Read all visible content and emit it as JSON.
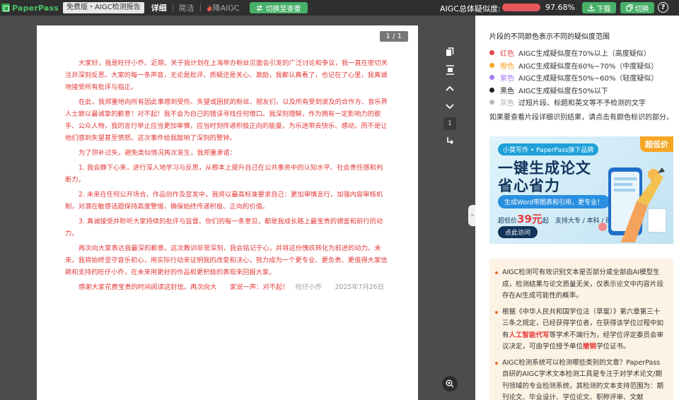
{
  "topbar": {
    "brand": "PaperPass",
    "version": "免费版・AIGC检测报告",
    "tabs": [
      "详细",
      "简洁"
    ],
    "lower_aigc": "降AIGC",
    "switch_check": "切换至查重",
    "score_label": "AIGC总体疑似度:",
    "score_value": "97.68%",
    "score_fraction": 0.9768,
    "download": "下载",
    "switch": "切换",
    "help": "?"
  },
  "viewer": {
    "page_counter": "1 / 1",
    "page_input": "1",
    "collapse": "»",
    "paragraphs": [
      "大家好，我是旺仔小乔。近期，关于我计划在上海举办粉丝见面会引发的广泛讨论和争议，我一直在密切关注并深刻反思。大家的每一条声音，无论是批评、质疑还是关心、激励，我都认真看了，也记在了心里，我真诚地接受所有批评与指正。",
      "在此，我郑重地向所有因此事感到受伤、失望或困扰的粉丝、朋友们，以及所有受到波及的合作方、音乐界人士致以最诚挚的歉意！对不起！我不会为自己的错误寻找任何借口。我深刻理解，作为拥有一定影响力的歌手、公众人物，我的言行举止应当更加审慎，应当时刻传递积极正向的能量，为乐迷带去快乐、感动，而不是让他们感到失望甚至愤怒。这次事件给我敲响了深刻的警钟。",
      "为了弥补过失，避免类似情况再次发生，我郑重承诺：",
      "1. 我会静下心来，进行深入地学习与反思，从根本上提升自己在公共事务中的认知水平、社会责任感和判断力。",
      "2. 未来在任何公开场合、作品创作及宣发中，我将以最高标准要求自己：更加审慎言行，加强内容审核机制，对潜在敏感话题保持高度警惕，确保始终传递积极、正向的价值。",
      "3. 真诚接受并聆听大家持续的批评与监督。你们的每一条意见，都是我成长路上最宝贵的镜鉴和前行的动力。",
      "再次向大家表达我最深的歉意。这次教训非常深刻，我会铭记于心，并将这份愧疚转化为前进的动力。未来，我将始终坚守音乐初心，用实际行动来证明我的改变和决心，努力成为一个更专业、更负责、更值得大家信赖和支持的旺仔小乔，在未来用更好的作品和更积极的表现来回报大家。",
      "感谢大家花费宝贵的时间阅读这封信。再次向大　　家说一声：对不起！"
    ],
    "signature": "　旺仔小乔　　2025年7月26日"
  },
  "panel": {
    "legend_title": "片段的不同颜色表示不同的疑似度范围",
    "legend": [
      {
        "color_name": "红色",
        "desc": "AIGC生成疑似度在70%以上（高度疑似）",
        "hex": "#e5484d"
      },
      {
        "color_name": "橙色",
        "desc": "AIGC生成疑似度在60%~70%（中度疑似）",
        "hex": "#f5a623"
      },
      {
        "color_name": "紫色",
        "desc": "AIGC生成疑似度在50%~60%（轻度疑似）",
        "hex": "#a77cf0"
      },
      {
        "color_name": "黑色",
        "desc": "AIGC生成疑似度在50%以下",
        "hex": "#222222"
      },
      {
        "color_name": "灰色",
        "desc": "过短片段、标题和英文等不予检测的文字",
        "hex": "#bbbbbb"
      }
    ],
    "legend_note": "如果要查看片段详细识别结果，请点击有颜色标识的部分。",
    "banner": {
      "tag": "小莫写作 • PaperPass旗下品牌",
      "corner": "超低价",
      "line1": "一键生成论文",
      "line2": "省心省力",
      "blue": "生成Word带图表和引用，更专业！",
      "price_prefix": "超低价",
      "price": "39元",
      "price_suffix": "起　支持大专 / 本科 / 硕士",
      "cta": "点此访问"
    },
    "info_items": [
      {
        "text": "AIGC检测可有效识别文本是否部分或全部由AI模型生成，检测结果与论文质量无关，仅表示论文中内容片段存在AI生成可能性的概率。"
      },
      {
        "pre": "根据《中华人民共和国学位法（草案）》第六章第三十三条之规定，已经获得学位者，在获得该学位过程中如有",
        "hl1": "人工智能代写",
        "mid": "等学术不端行为，经学位评定委员会审议决定，可由学位授予单位",
        "hl2": "撤销",
        "post": "学位证书。"
      },
      {
        "text": "AIGC检测系统可以检测哪些类别的文章？PaperPass自研的AIGC学术文本检测工具是专注于对学术论文/期刊领域的专业检测系统，其检测的文本支持范围为：期刊论文、毕业设计、学位论文、职称评审、文献"
      }
    ]
  }
}
